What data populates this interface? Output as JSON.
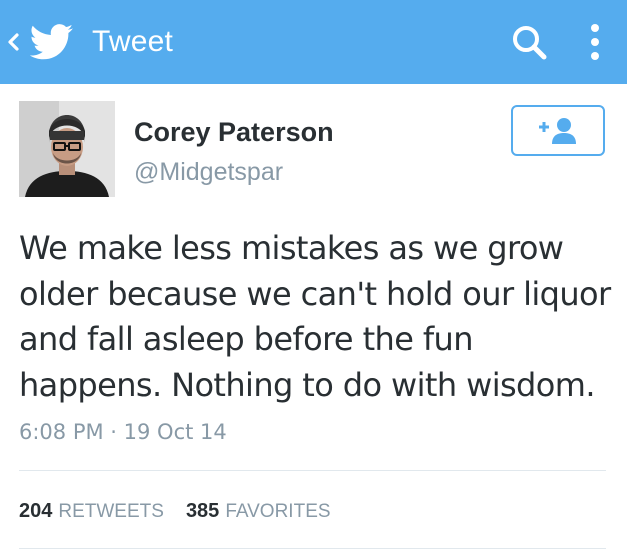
{
  "app_bar": {
    "title": "Tweet",
    "background_color": "#55acee",
    "back_icon": "chevron-left-icon",
    "logo_icon": "twitter-bird-icon",
    "search_icon": "search-icon",
    "overflow_icon": "overflow-menu-icon"
  },
  "author": {
    "name": "Corey Paterson",
    "handle": "@Midgetspar",
    "follow_icon": "add-user-icon"
  },
  "tweet": {
    "text": "We make less mistakes as we grow older because we can't hold our liquor and fall asleep before the fun happens. Nothing to do with wisdom.",
    "timestamp": "6:08 PM · 19 Oct 14"
  },
  "stats": {
    "retweets_count": "204",
    "retweets_label": "RETWEETS",
    "favorites_count": "385",
    "favorites_label": "FAVORITES"
  },
  "colors": {
    "accent": "#55acee",
    "text_primary": "#292f33",
    "text_secondary": "#8899a6",
    "divider": "#e1e8ed"
  }
}
